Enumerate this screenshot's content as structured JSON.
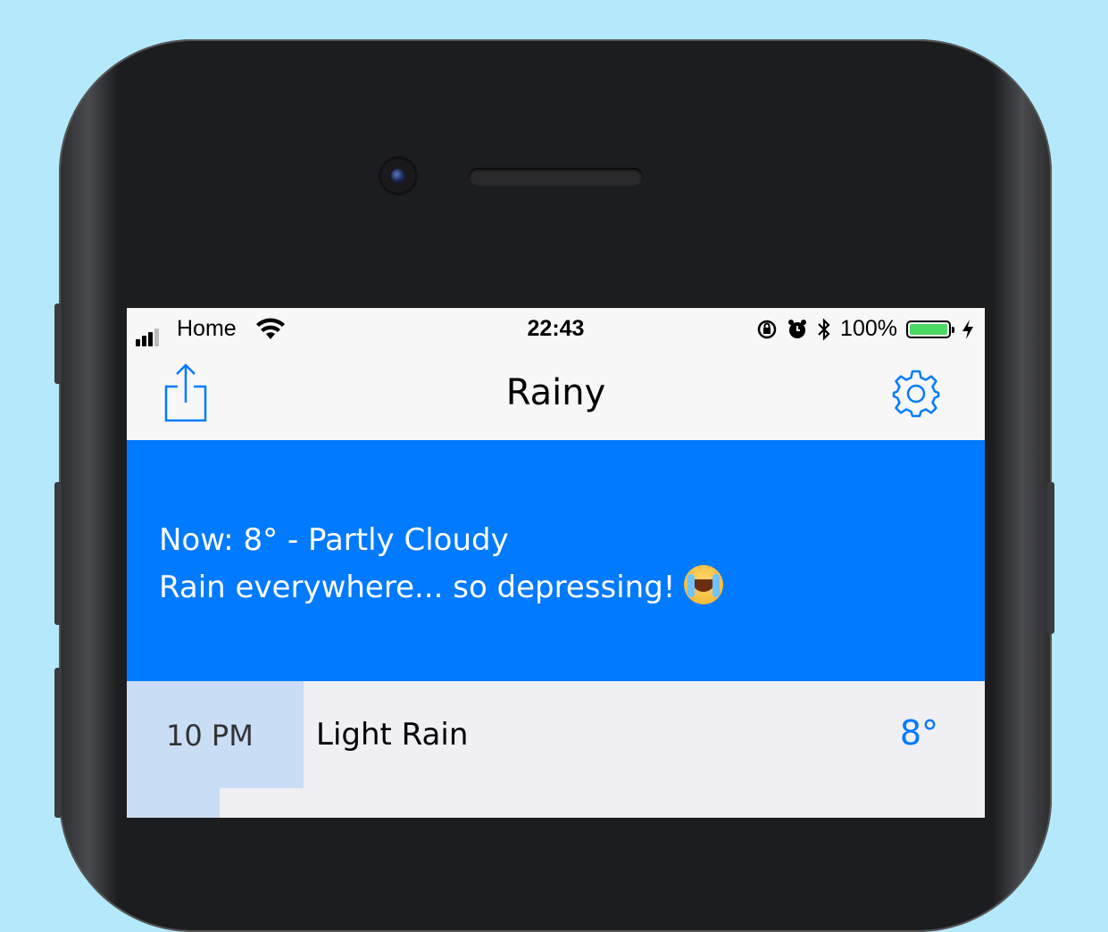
{
  "statusbar": {
    "carrier": "Home",
    "time": "22:43",
    "battery": "100%",
    "battery_level": 1.0,
    "icons": [
      "signal-icon",
      "wifi-icon",
      "orientation-lock-icon",
      "alarm-icon",
      "bluetooth-icon",
      "battery-icon",
      "charging-icon"
    ]
  },
  "navbar": {
    "title": "Rainy",
    "left_button_icon": "share-icon",
    "right_button_icon": "gear-icon"
  },
  "banner": {
    "line1": "Now: 8° - Partly Cloudy",
    "line2": "Rain everywhere... so depressing!",
    "emoji": "loudly-crying-face"
  },
  "forecast": [
    {
      "hour": "10 PM",
      "condition": "Light Rain",
      "temp": "8°"
    }
  ],
  "colors": {
    "background": "#b3e9fb",
    "accent": "#007aff",
    "hour_cell": "#c9def4"
  }
}
